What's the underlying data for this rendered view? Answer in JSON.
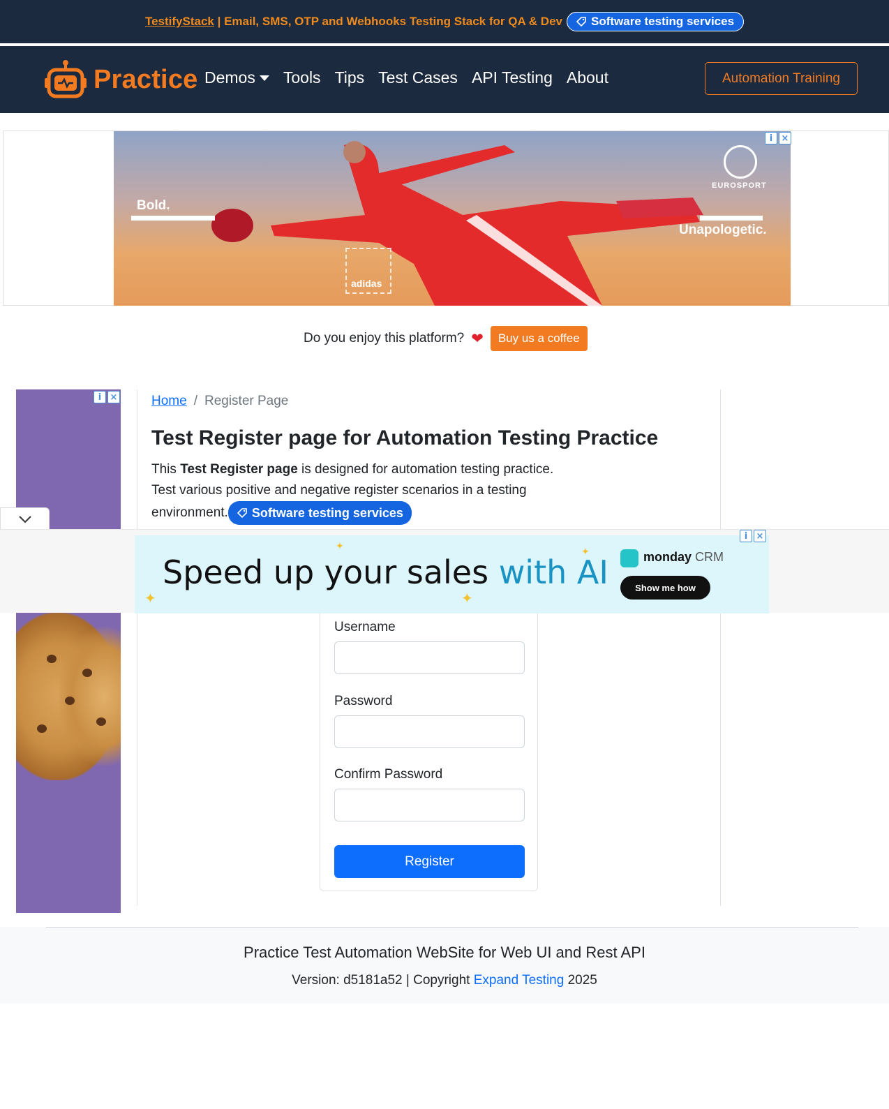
{
  "topbar": {
    "brand_link": "TestifyStack",
    "promo_text": " | Email, SMS, OTP and Webhooks Testing Stack for QA & Dev",
    "services_pill": "Software testing services"
  },
  "navbar": {
    "brand": "Practice",
    "links": [
      "Demos",
      "Tools",
      "Tips",
      "Test Cases",
      "API Testing",
      "About"
    ],
    "training_button": "Automation Training"
  },
  "ad_top": {
    "left_text": "Bold.",
    "right_text": "Unapologetic.",
    "sponsor": "EUROSPORT",
    "brand": "adidas"
  },
  "coffee": {
    "question": "Do you enjoy this platform?",
    "button": "Buy us a coffee"
  },
  "breadcrumb": {
    "home": "Home",
    "separator": "/",
    "current": "Register Page"
  },
  "main": {
    "title": "Test Register page for Automation Testing Practice",
    "desc_pre": "This ",
    "desc_bold": "Test Register page",
    "desc_post": " is designed for automation testing practice. Test various positive and negative register scenarios in a testing environment.",
    "services_pill": "Software testing services"
  },
  "form": {
    "username_label": "Username",
    "password_label": "Password",
    "confirm_label": "Confirm Password",
    "username_value": "",
    "password_value": "",
    "confirm_value": "",
    "register_button": "Register"
  },
  "ad_sticky": {
    "headline": "Speed up your sales ",
    "headline_accent": "with AI",
    "brand": "monday",
    "brand_suffix": " CRM",
    "cta": "Show me how"
  },
  "footer": {
    "title": "Practice Test Automation WebSite for Web UI and Rest API",
    "version_text": "Version: d5181a52 | Copyright ",
    "company_link": "Expand Testing",
    "year": " 2025"
  },
  "colors": {
    "navy": "#1b2a3e",
    "orange": "#f27a20",
    "primary": "#0d6efd",
    "pill_blue": "#1565e0"
  }
}
